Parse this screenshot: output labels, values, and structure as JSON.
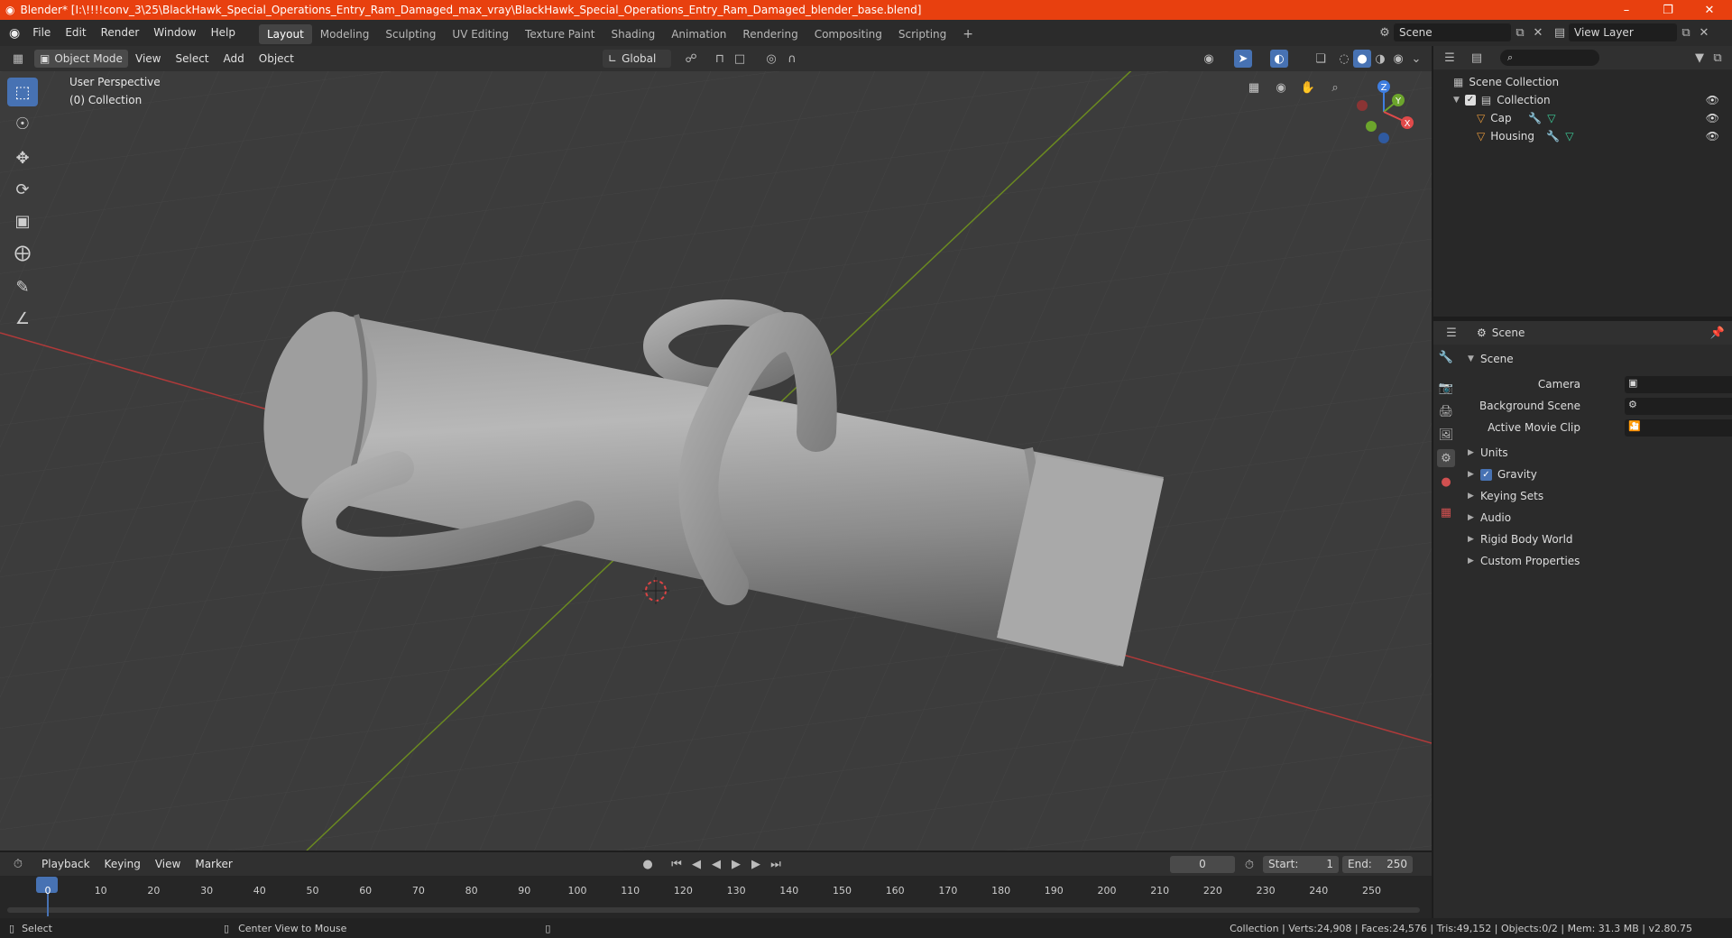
{
  "window": {
    "title": "Blender* [I:\\!!!!conv_3\\25\\BlackHawk_Special_Operations_Entry_Ram_Damaged_max_vray\\BlackHawk_Special_Operations_Entry_Ram_Damaged_blender_base.blend]",
    "minimize": "–",
    "maximize": "❐",
    "close": "✕"
  },
  "menu": [
    "File",
    "Edit",
    "Render",
    "Window",
    "Help"
  ],
  "workspaces": [
    "Layout",
    "Modeling",
    "Sculpting",
    "UV Editing",
    "Texture Paint",
    "Shading",
    "Animation",
    "Rendering",
    "Compositing",
    "Scripting"
  ],
  "active_workspace": "Layout",
  "scene_selector": "Scene",
  "view_layer": "View Layer",
  "viewport_header": {
    "mode": "Object Mode",
    "menus": [
      "View",
      "Select",
      "Add",
      "Object"
    ],
    "orientation": "Global"
  },
  "viewport": {
    "perspective": "User Perspective",
    "collection": "(0) Collection",
    "gizmo": {
      "x": "X",
      "y": "Y",
      "z": "Z"
    }
  },
  "outliner": {
    "root": "Scene Collection",
    "collection": "Collection",
    "items": [
      "Cap",
      "Housing"
    ]
  },
  "properties": {
    "header": "Scene",
    "panel_title": "Scene",
    "fields": [
      {
        "label": "Camera"
      },
      {
        "label": "Background Scene"
      },
      {
        "label": "Active Movie Clip"
      }
    ],
    "sections": [
      "Units",
      "Gravity",
      "Keying Sets",
      "Audio",
      "Rigid Body World",
      "Custom Properties"
    ],
    "gravity_checked": true
  },
  "timeline": {
    "menus": [
      "Playback",
      "Keying",
      "View",
      "Marker"
    ],
    "current_frame": "0",
    "start_label": "Start:",
    "start": "1",
    "end_label": "End:",
    "end": "250",
    "ticks": [
      "0",
      "10",
      "20",
      "30",
      "40",
      "50",
      "60",
      "70",
      "80",
      "90",
      "100",
      "110",
      "120",
      "130",
      "140",
      "150",
      "160",
      "170",
      "180",
      "190",
      "200",
      "210",
      "220",
      "230",
      "240",
      "250"
    ]
  },
  "status": {
    "left": "Select",
    "middle": "Center View to Mouse",
    "right": "Collection | Verts:24,908 | Faces:24,576 | Tris:49,152 | Objects:0/2 | Mem: 31.3 MB | v2.80.75"
  },
  "colors": {
    "title_bar": "#e8400f",
    "accent": "#4772b3",
    "x_axis": "#b03a3a",
    "y_axis": "#6b8a20"
  }
}
